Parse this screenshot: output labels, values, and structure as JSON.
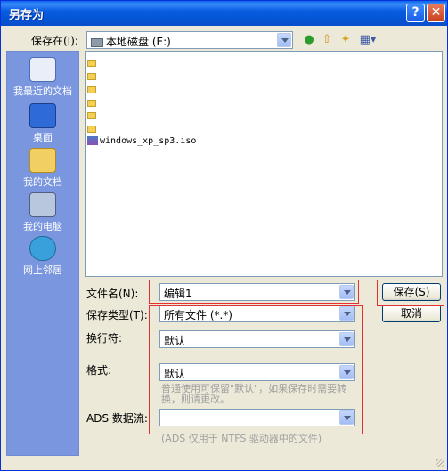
{
  "window": {
    "title": "另存为"
  },
  "lookin": {
    "label": "保存在(I):",
    "value": "本地磁盘 (E:)"
  },
  "places": [
    {
      "label": "我最近的文档",
      "icon": "recent-docs-icon"
    },
    {
      "label": "桌面",
      "icon": "desktop-icon"
    },
    {
      "label": "我的文档",
      "icon": "my-documents-icon"
    },
    {
      "label": "我的电脑",
      "icon": "my-computer-icon"
    },
    {
      "label": "网上邻居",
      "icon": "network-places-icon"
    }
  ],
  "files": {
    "iso_name": "windows_xp_sp3.iso"
  },
  "filename": {
    "label": "文件名(N):",
    "value": "编辑1"
  },
  "filetype": {
    "label": "保存类型(T):",
    "value": "所有文件 (*.*)"
  },
  "newline": {
    "label": "换行符:",
    "value": "默认"
  },
  "format": {
    "label": "格式:",
    "value": "默认",
    "hint": "普通使用可保留\"默认\"，如果保存时需要转换，则请更改。"
  },
  "ads": {
    "label": "ADS 数据流:",
    "value": "",
    "hint": "(ADS 仅用于 NTFS 驱动器中的文件)"
  },
  "buttons": {
    "save": "保存(S)",
    "cancel": "取消"
  },
  "colors": {
    "title_bar": "#0a5ce0",
    "places_bar": "#7a96df",
    "highlight_box": "#e53030"
  }
}
